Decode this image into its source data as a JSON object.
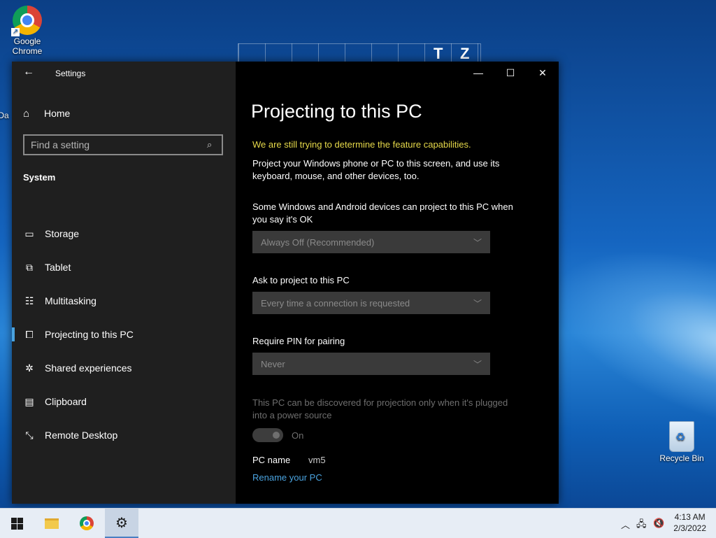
{
  "desktop": {
    "grid_letters": [
      "T",
      "Z"
    ],
    "icons": {
      "chrome_label_line1": "Google",
      "chrome_label_line2": "Chrome",
      "recycle_label": "Recycle Bin",
      "partial_label": "Da"
    }
  },
  "window": {
    "title": "Settings",
    "controls": {
      "minimize": "—",
      "maximize": "☐",
      "close": "✕"
    }
  },
  "sidebar": {
    "home_label": "Home",
    "search_placeholder": "Find a setting",
    "section_label": "System",
    "items": [
      {
        "label": "Storage",
        "icon": "storage-icon",
        "glyph": "▭",
        "active": false
      },
      {
        "label": "Tablet",
        "icon": "tablet-icon",
        "glyph": "⧉",
        "active": false
      },
      {
        "label": "Multitasking",
        "icon": "multitasking-icon",
        "glyph": "☷",
        "active": false
      },
      {
        "label": "Projecting to this PC",
        "icon": "projecting-icon",
        "glyph": "⧠",
        "active": true
      },
      {
        "label": "Shared experiences",
        "icon": "shared-experiences-icon",
        "glyph": "✲",
        "active": false
      },
      {
        "label": "Clipboard",
        "icon": "clipboard-icon",
        "glyph": "▤",
        "active": false
      },
      {
        "label": "Remote Desktop",
        "icon": "remote-desktop-icon",
        "glyph": "⤡",
        "active": false
      }
    ]
  },
  "main": {
    "title": "Projecting to this PC",
    "warning": "We are still trying to determine the feature capabilities.",
    "intro_line1": "Project your Windows phone or PC to this screen, and use its",
    "intro_line2": "keyboard, mouse, and other devices, too.",
    "setting1_line1": "Some Windows and Android devices can project to this PC when",
    "setting1_line2": "you say it's OK",
    "setting1_value": "Always Off (Recommended)",
    "setting2_label": "Ask to project to this PC",
    "setting2_value": "Every time a connection is requested",
    "setting3_label": "Require PIN for pairing",
    "setting3_value": "Never",
    "power_line1": "This PC can be discovered for projection only when it's plugged",
    "power_line2": "into a power source",
    "toggle_label": "On",
    "pc_name_label": "PC name",
    "pc_name_value": "vm5",
    "rename_link": "Rename your PC"
  },
  "taskbar": {
    "time": "4:13 AM",
    "date": "2/3/2022"
  },
  "colors": {
    "accent": "#4aa3df",
    "warning": "#e6d94a",
    "sidebar_bg": "#1f1f1f",
    "content_bg": "#000000"
  }
}
